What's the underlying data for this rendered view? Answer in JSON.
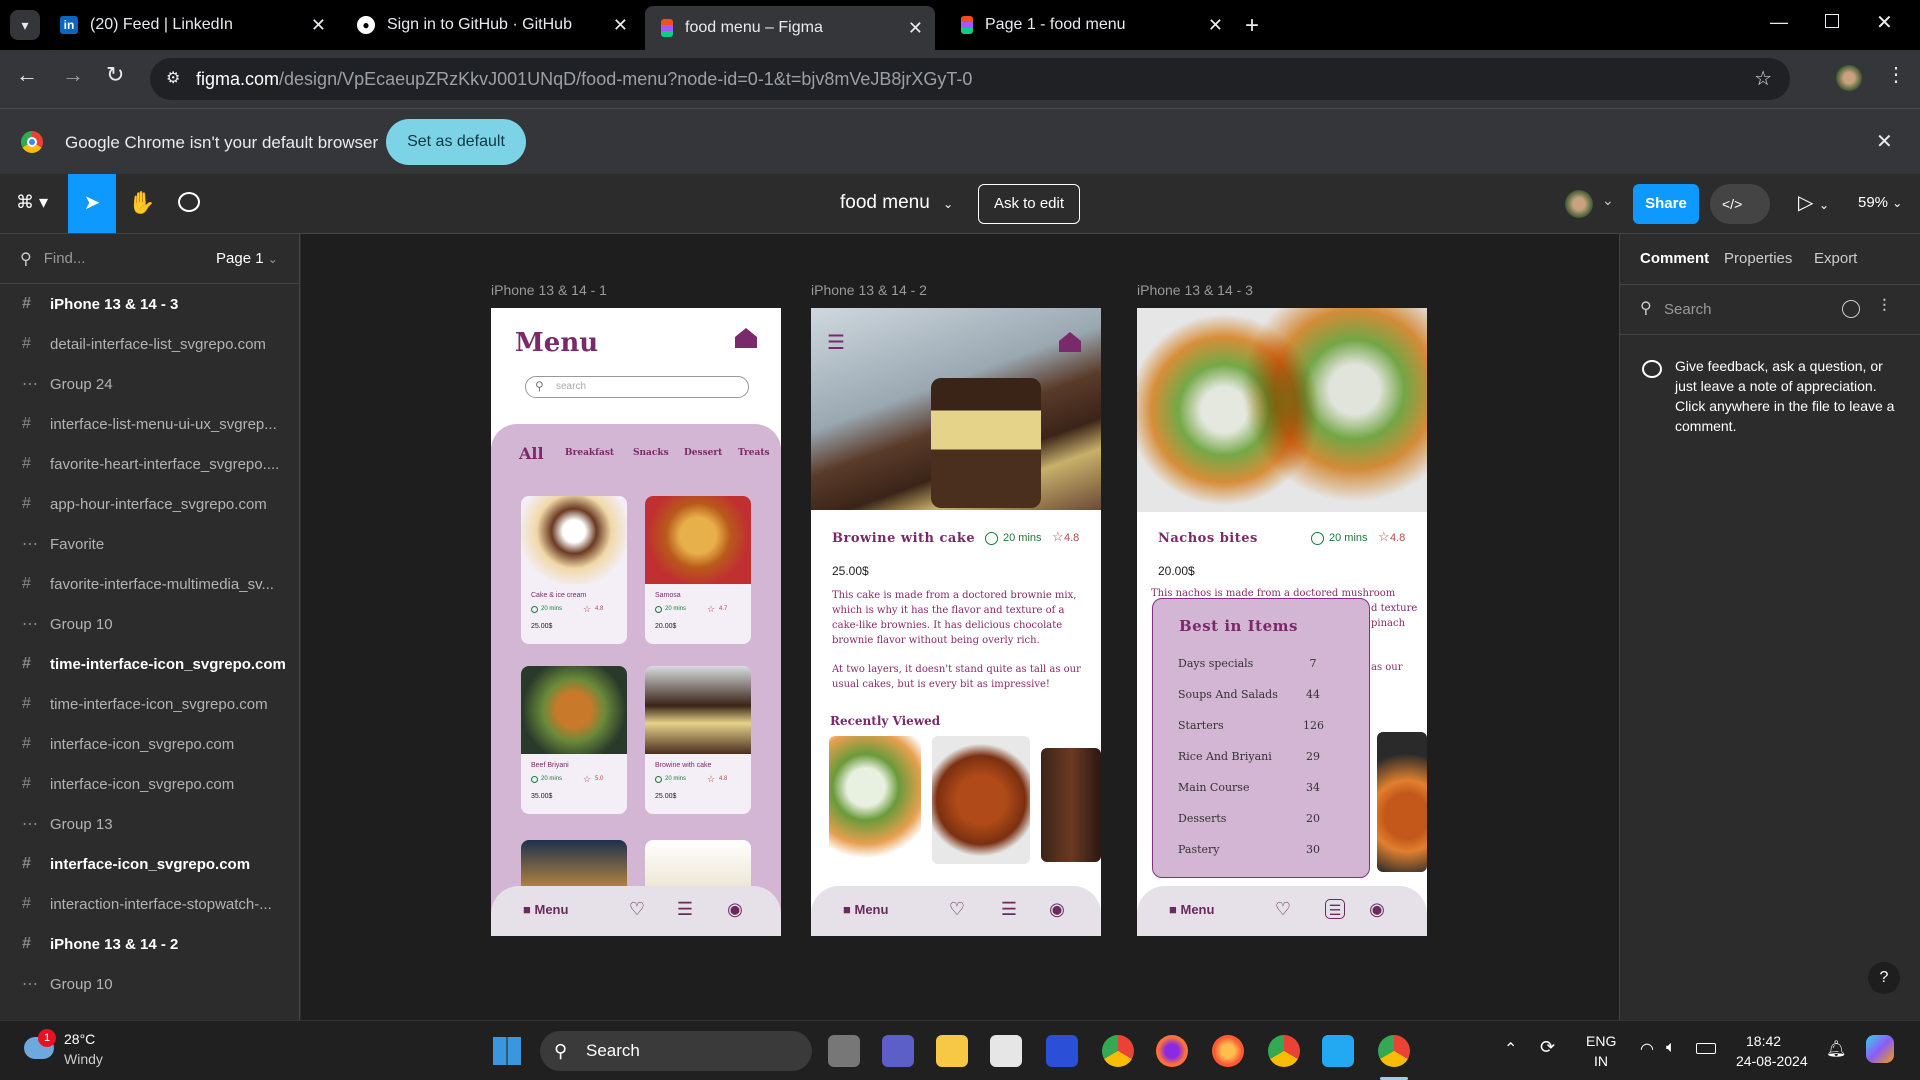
{
  "browser": {
    "tabs": [
      {
        "title": "(20) Feed | LinkedIn",
        "icon": "linkedin-icon"
      },
      {
        "title": "Sign in to GitHub · GitHub",
        "icon": "github-icon"
      },
      {
        "title": "food menu – Figma",
        "icon": "figma-icon"
      },
      {
        "title": "Page 1 - food menu",
        "icon": "figma-icon"
      }
    ],
    "url_host": "figma.com",
    "url_path": "/design/VpEcaeupZRzKkvJ001UNqD/food-menu?node-id=0-1&t=bjv8mVeJB8jrXGyT-0",
    "infobar_text": "Google Chrome isn't your default browser",
    "infobar_button": "Set as default"
  },
  "figma": {
    "file_name": "food menu",
    "ask_to_edit": "Ask to edit",
    "share": "Share",
    "zoom": "59%",
    "find_placeholder": "Find...",
    "page": "Page 1",
    "layers": [
      {
        "name": "iPhone 13 & 14 - 3",
        "bold": true,
        "icon": "#"
      },
      {
        "name": "detail-interface-list_svgrepo.com",
        "bold": false,
        "icon": "#"
      },
      {
        "name": "Group 24",
        "bold": false,
        "icon": "dots"
      },
      {
        "name": "interface-list-menu-ui-ux_svgrep...",
        "bold": false,
        "icon": "#"
      },
      {
        "name": "favorite-heart-interface_svgrepo....",
        "bold": false,
        "icon": "#"
      },
      {
        "name": "app-hour-interface_svgrepo.com",
        "bold": false,
        "icon": "#"
      },
      {
        "name": "Favorite",
        "bold": false,
        "icon": "dots"
      },
      {
        "name": "favorite-interface-multimedia_sv...",
        "bold": false,
        "icon": "#"
      },
      {
        "name": "Group 10",
        "bold": false,
        "icon": "dots"
      },
      {
        "name": "time-interface-icon_svgrepo.com",
        "bold": true,
        "icon": "#"
      },
      {
        "name": "time-interface-icon_svgrepo.com",
        "bold": false,
        "icon": "#"
      },
      {
        "name": "interface-icon_svgrepo.com",
        "bold": false,
        "icon": "#"
      },
      {
        "name": "interface-icon_svgrepo.com",
        "bold": false,
        "icon": "#"
      },
      {
        "name": "Group 13",
        "bold": false,
        "icon": "dots"
      },
      {
        "name": "interface-icon_svgrepo.com",
        "bold": true,
        "icon": "#"
      },
      {
        "name": "interaction-interface-stopwatch-...",
        "bold": false,
        "icon": "#"
      },
      {
        "name": "iPhone 13 & 14 - 2",
        "bold": true,
        "icon": "#"
      },
      {
        "name": "Group 10",
        "bold": false,
        "icon": "dots"
      }
    ],
    "right_tabs": [
      "Comment",
      "Properties",
      "Export"
    ],
    "comment_search": "Search",
    "comment_hint": "Give feedback, ask a question, or just leave a note of appreciation. Click anywhere in the file to leave a comment."
  },
  "frames": {
    "f1": {
      "label": "iPhone 13 & 14 - 1",
      "title": "Menu",
      "search": "search",
      "categories": [
        "All",
        "Breakfast",
        "Snacks",
        "Dessert",
        "Treats"
      ],
      "cards": [
        {
          "name": "Cake & ice cream",
          "time": "20 mins",
          "rating": "4.8",
          "price": "25.00$"
        },
        {
          "name": "Samosa",
          "time": "20 mins",
          "rating": "4.7",
          "price": "20.00$"
        },
        {
          "name": "Beef Briyani",
          "time": "20 mins",
          "rating": "5.0",
          "price": "35.00$"
        },
        {
          "name": "Browine with cake",
          "time": "20 mins",
          "rating": "4.8",
          "price": "25.00$"
        }
      ],
      "nav": "Menu"
    },
    "f2": {
      "label": "iPhone 13 & 14 - 2",
      "title": "Browine with cake",
      "time": "20 mins",
      "rating": "4.8",
      "price": "25.00$",
      "desc1": "This cake is made from a doctored brownie mix, which is why it has the flavor and texture of a cake-like brownies. It has delicious chocolate brownie flavor without being overly rich.",
      "desc2": "At two layers, it doesn't stand quite as tall as our usual cakes, but is every bit as impressive!",
      "recent": "Recently Viewed",
      "nav": "Menu"
    },
    "f3": {
      "label": "iPhone 13 & 14 - 3",
      "title": "Nachos bites",
      "time": "20 mins",
      "rating": "4.8",
      "price": "20.00$",
      "desc1": "This nachos is made from a doctored mushroom",
      "desc1b": "d texture",
      "desc1c": "pinach",
      "desc2": "as our",
      "popup_title": "Best in Items",
      "items": [
        {
          "name": "Days specials",
          "count": "7"
        },
        {
          "name": "Soups And Salads",
          "count": "44"
        },
        {
          "name": "Starters",
          "count": "126"
        },
        {
          "name": "Rice And Briyani",
          "count": "29"
        },
        {
          "name": "Main Course",
          "count": "34"
        },
        {
          "name": "Desserts",
          "count": "20"
        },
        {
          "name": "Pastery",
          "count": "30"
        }
      ],
      "nav": "Menu"
    }
  },
  "taskbar": {
    "temp": "28°C",
    "weather": "Windy",
    "search": "Search",
    "lang1": "ENG",
    "lang2": "IN",
    "time": "18:42",
    "date": "24-08-2024",
    "badge": "1"
  }
}
